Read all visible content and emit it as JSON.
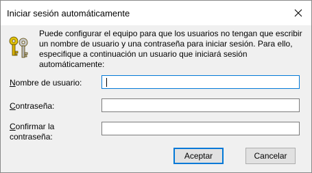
{
  "window": {
    "title": "Iniciar sesión automáticamente"
  },
  "icons": {
    "keys": "keys-icon",
    "close": "close-icon"
  },
  "description": {
    "line1": "Puede configurar el equipo para que los usuarios no tengan que escribir",
    "line2": "un nombre de usuario y una contraseña para iniciar sesión. Para ello,",
    "line3": "especifique a continuación un usuario que iniciará sesión",
    "line4": "automáticamente:"
  },
  "fields": {
    "username": {
      "label_mnemonic": "N",
      "label_rest": "ombre de usuario:",
      "value": ""
    },
    "password": {
      "label_mnemonic": "C",
      "label_rest": "ontraseña:",
      "value": ""
    },
    "confirm": {
      "label_mnemonic": "C",
      "label_rest": "onfirmar la",
      "label_line2": "contraseña:",
      "value": ""
    }
  },
  "buttons": {
    "accept": "Aceptar",
    "cancel": "Cancelar"
  },
  "colors": {
    "accent": "#0078d7",
    "key_gold": "#d9b300"
  }
}
